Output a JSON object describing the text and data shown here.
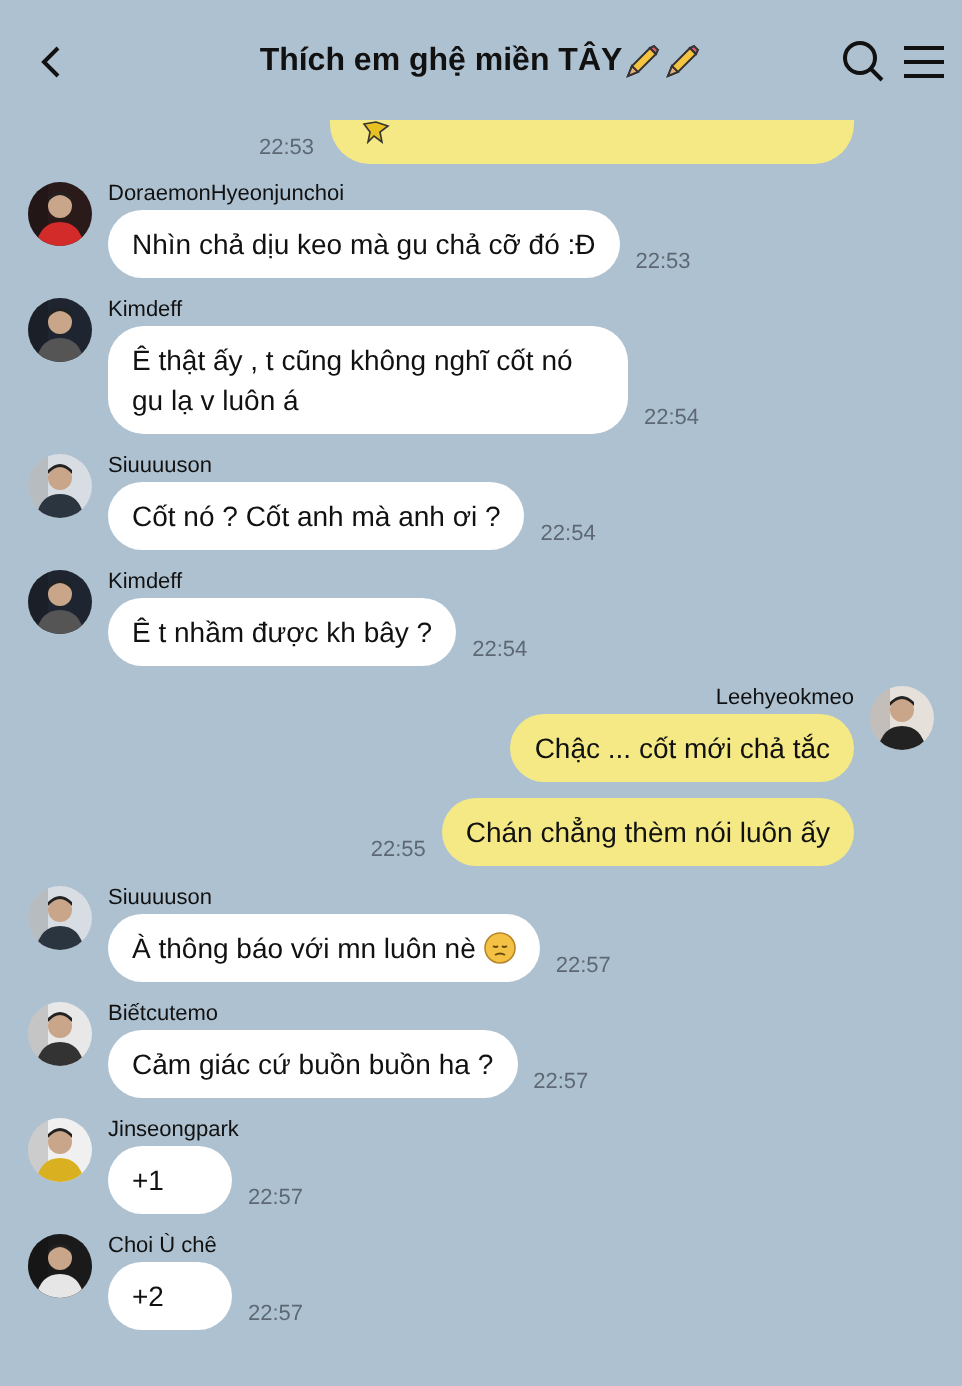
{
  "header": {
    "title": "Thích em ghệ miền TÂY"
  },
  "top_partial": {
    "time": "22:53"
  },
  "messages": [
    {
      "kind": "in",
      "sender": "DoraemonHyeonjunchoi",
      "text": "Nhìn chả dịu keo mà gu chả cỡ đó :Đ",
      "time": "22:53"
    },
    {
      "kind": "in",
      "sender": "Kimdeff",
      "text": "Ê thật ấy , t cũng không nghĩ cốt nó gu lạ v luôn á",
      "time": "22:54"
    },
    {
      "kind": "in",
      "sender": "Siuuuuson",
      "text": "Cốt nó ? Cốt anh mà anh ơi ?",
      "time": "22:54"
    },
    {
      "kind": "in",
      "sender": "Kimdeff",
      "text": "Ê t nhầm được kh bây ?",
      "time": "22:54"
    },
    {
      "kind": "out",
      "sender": "Leehyeokmeo",
      "bubbles": [
        {
          "text": "Chậc ... cốt mới chả tắc"
        },
        {
          "text": "Chán chẳng thèm nói luôn ấy",
          "time": "22:55"
        }
      ]
    },
    {
      "kind": "in",
      "sender": "Siuuuuson",
      "text": "À thông báo với mn luôn nè",
      "time": "22:57"
    },
    {
      "kind": "in",
      "sender": "Biếtcutemo",
      "text": "Cảm giác cứ buồn buồn ha ?",
      "time": "22:57"
    },
    {
      "kind": "in",
      "sender": "Jinseongpark",
      "text": "+1",
      "time": "22:57"
    },
    {
      "kind": "in",
      "sender": "Choi Ù chê",
      "text": "+2",
      "time": "22:57"
    }
  ]
}
